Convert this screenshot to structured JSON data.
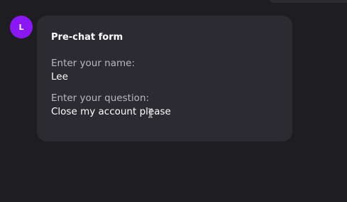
{
  "avatar": {
    "initial": "L",
    "color": "#8b17f5"
  },
  "message": {
    "title": "Pre-chat form",
    "fields": [
      {
        "label": "Enter your name:",
        "value": "Lee"
      },
      {
        "label": "Enter your question:",
        "value": "Close my account please"
      }
    ]
  },
  "cursor": {
    "icon": "text-cursor-icon"
  }
}
